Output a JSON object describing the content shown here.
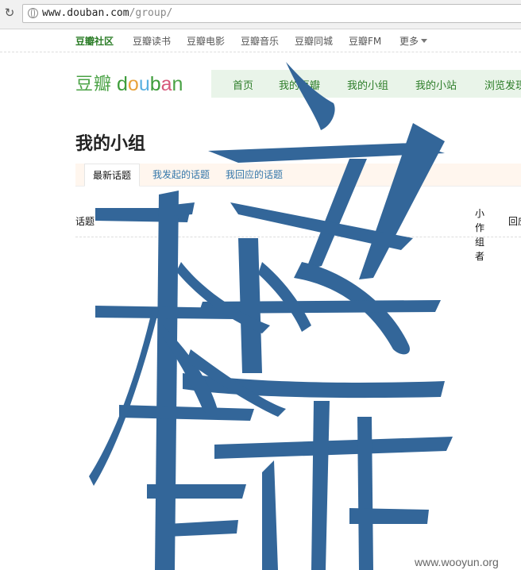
{
  "browser": {
    "url_host": "www.douban.com",
    "url_path": "/group/"
  },
  "global_nav": {
    "items": [
      "豆瓣社区",
      "豆瓣读书",
      "豆瓣电影",
      "豆瓣音乐",
      "豆瓣同城",
      "豆瓣FM"
    ],
    "more_label": "更多"
  },
  "logo": {
    "cn": "豆瓣",
    "en": [
      "d",
      "o",
      "u",
      "b",
      "a",
      "n"
    ]
  },
  "site_nav": {
    "items": [
      "首页",
      "我的豆瓣",
      "我的小组",
      "我的小站",
      "浏览发现"
    ]
  },
  "page": {
    "title": "我的小组"
  },
  "tabs": [
    "最新话题",
    "我发起的话题",
    "我回应的话题"
  ],
  "table": {
    "col_topic": "话题",
    "col_group_author": "小 作 组 者",
    "col_reply": "回应"
  },
  "overlay": {
    "glyph_color": "#336699",
    "description_glyph": "large stylized character graphic"
  },
  "watermark": "www.wooyun.org",
  "colors": {
    "accent_green": "#2c7d28",
    "nav_bg": "#e9f4e9",
    "tab_bg": "#fff6ee"
  }
}
